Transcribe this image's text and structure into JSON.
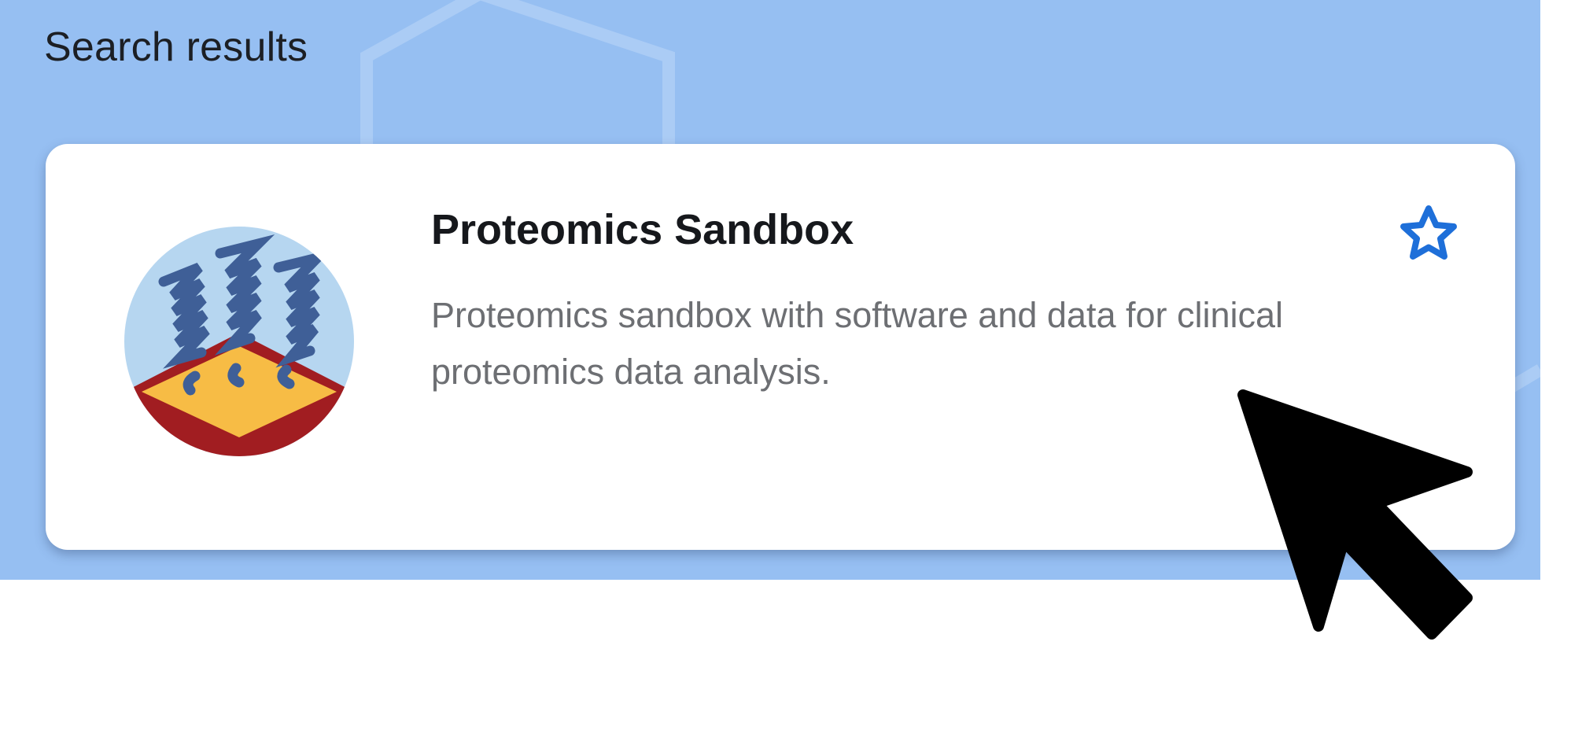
{
  "page": {
    "section_title": "Search results"
  },
  "result_card": {
    "title": "Proteomics Sandbox",
    "description": "Proteomics sandbox with software and data for clinical proteomics data analysis.",
    "logo_icon": "protein-helices-on-membrane-icon",
    "favorite_icon": "star-outline-icon",
    "favorited": false
  },
  "colors": {
    "panel_background": "#96bff2",
    "card_background": "#ffffff",
    "accent_blue": "#1e6fd9",
    "title_text": "#16181c",
    "description_text": "#6d6f73",
    "logo_circle": "#b6d6f0",
    "logo_helix": "#3f5f97",
    "logo_membrane_top": "#f7bc45",
    "logo_membrane_base": "#a11d21"
  }
}
